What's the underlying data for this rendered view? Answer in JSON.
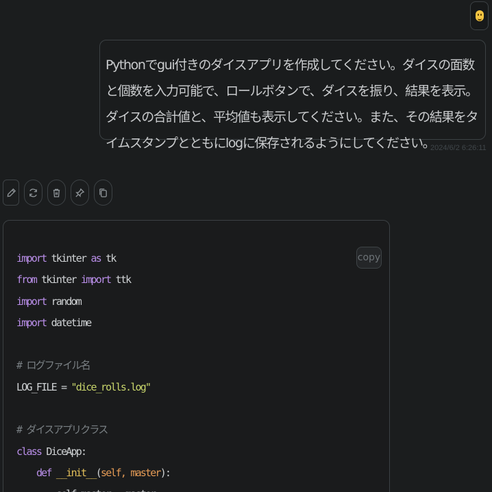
{
  "user_message": {
    "text": "Pythonでgui付きのダイスアプリを作成してください。ダイスの面数と個数を入力可能で、ロールボタンで、ダイスを振り、結果を表示。ダイスの合計値と、平均値も表示してください。また、その結果をタイムスタンプとともにlogに保存されるようにしてください。",
    "timestamp": "2024/6/2 6:26:11"
  },
  "avatar": {
    "icon": "smiley-icon"
  },
  "actions": [
    {
      "name": "edit-button",
      "icon": "pencil-icon"
    },
    {
      "name": "regenerate-button",
      "icon": "refresh-icon"
    },
    {
      "name": "delete-button",
      "icon": "trash-icon"
    },
    {
      "name": "pin-button",
      "icon": "pin-icon"
    },
    {
      "name": "copy-message-button",
      "icon": "copy-icon"
    }
  ],
  "code_block": {
    "copy_label": "copy",
    "lines": [
      [
        {
          "t": "import",
          "c": "kw"
        },
        {
          "t": " tkinter "
        },
        {
          "t": "as",
          "c": "kw"
        },
        {
          "t": " tk"
        }
      ],
      [
        {
          "t": "from",
          "c": "kw"
        },
        {
          "t": " tkinter "
        },
        {
          "t": "import",
          "c": "kw"
        },
        {
          "t": " ttk"
        }
      ],
      [
        {
          "t": "import",
          "c": "kw"
        },
        {
          "t": " random"
        }
      ],
      [
        {
          "t": "import",
          "c": "kw"
        },
        {
          "t": " datetime"
        }
      ],
      [],
      [
        {
          "t": "# ログファイル名",
          "c": "cm"
        }
      ],
      [
        {
          "t": "LOG_FILE = "
        },
        {
          "t": "\"dice_rolls.log\"",
          "c": "st"
        }
      ],
      [],
      [
        {
          "t": "# ダイスアプリクラス",
          "c": "cm"
        }
      ],
      [
        {
          "t": "class",
          "c": "kw"
        },
        {
          "t": " DiceApp:"
        }
      ],
      [
        {
          "t": "    "
        },
        {
          "t": "def",
          "c": "kw"
        },
        {
          "t": " "
        },
        {
          "t": "__init__",
          "c": "fn"
        },
        {
          "t": "("
        },
        {
          "t": "self, master",
          "c": "pm"
        },
        {
          "t": "):"
        }
      ],
      [
        {
          "t": "        self.master = master"
        }
      ]
    ]
  },
  "colors": {
    "background": "#1b1d1e",
    "keyword": "#b98ee8",
    "string": "#c7d46b",
    "comment": "#7a8084",
    "function": "#e4c05a",
    "param": "#e39a55"
  }
}
